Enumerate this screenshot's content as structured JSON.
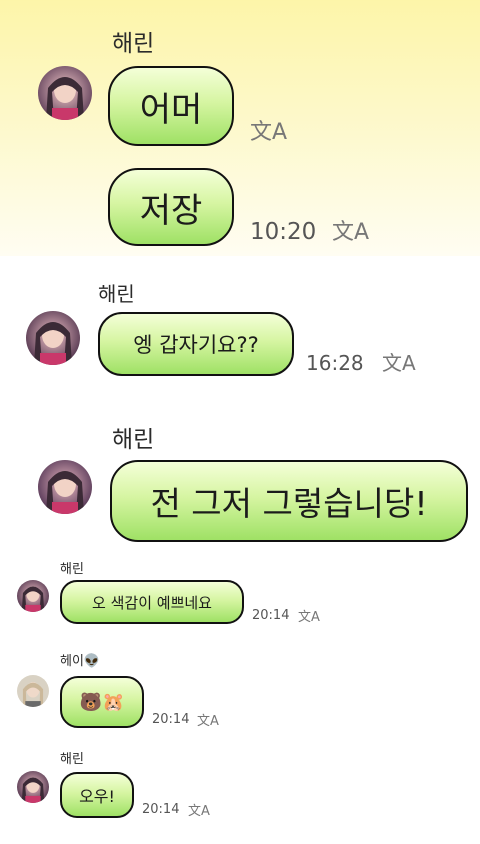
{
  "panel1": {
    "sender": "해린",
    "messages": [
      {
        "text": "어머",
        "time": ""
      },
      {
        "text": "저장",
        "time": "10:20"
      }
    ]
  },
  "panel2": {
    "sender": "해린",
    "message": {
      "text": "엥 갑자기요??",
      "time": "16:28"
    }
  },
  "panel3": {
    "sender": "해린",
    "message": {
      "text": "전 그저 그렇습니당!",
      "time": ""
    }
  },
  "panel4": {
    "messages": [
      {
        "sender": "해린",
        "text": "오 색감이 예쁘네요",
        "time": "20:14"
      },
      {
        "sender": "헤이👽",
        "text": "🐻🐹",
        "time": "20:14"
      },
      {
        "sender": "해린",
        "text": "오우!",
        "time": "20:14"
      }
    ]
  },
  "icons": {
    "translate": "translate-icon",
    "avatar": "profile-avatar"
  },
  "colors": {
    "bubble_top": "#f4ffd8",
    "bubble_bottom": "#9fe165",
    "bubble_border": "#111111",
    "panel1_bg": "#fdf5a9"
  }
}
